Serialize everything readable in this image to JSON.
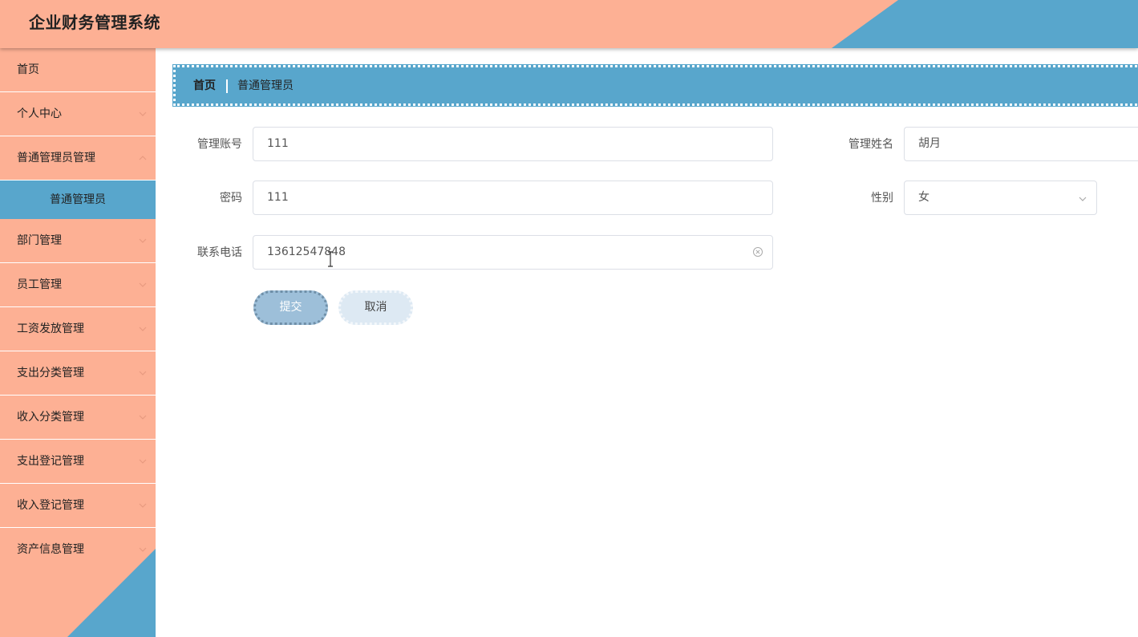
{
  "header": {
    "title": "企业财务管理系统"
  },
  "sidebar": {
    "items": [
      {
        "label": "首页"
      },
      {
        "label": "个人中心"
      },
      {
        "label": "普通管理员管理"
      },
      {
        "label": "普通管理员"
      },
      {
        "label": "部门管理"
      },
      {
        "label": "员工管理"
      },
      {
        "label": "工资发放管理"
      },
      {
        "label": "支出分类管理"
      },
      {
        "label": "收入分类管理"
      },
      {
        "label": "支出登记管理"
      },
      {
        "label": "收入登记管理"
      },
      {
        "label": "资产信息管理"
      }
    ]
  },
  "breadcrumb": {
    "home": "首页",
    "current": "普通管理员"
  },
  "form": {
    "account": {
      "label": "管理账号",
      "value": "111"
    },
    "name": {
      "label": "管理姓名",
      "value": "胡月"
    },
    "password": {
      "label": "密码",
      "value": "111"
    },
    "gender": {
      "label": "性别",
      "value": "女"
    },
    "phone": {
      "label": "联系电话",
      "value": "13612547848"
    },
    "submit_label": "提交",
    "cancel_label": "取消"
  },
  "colors": {
    "salmon": "#FDB094",
    "blue": "#58A6CC",
    "submit_bg": "#9DBFD9",
    "cancel_bg": "#DDE9F3"
  }
}
